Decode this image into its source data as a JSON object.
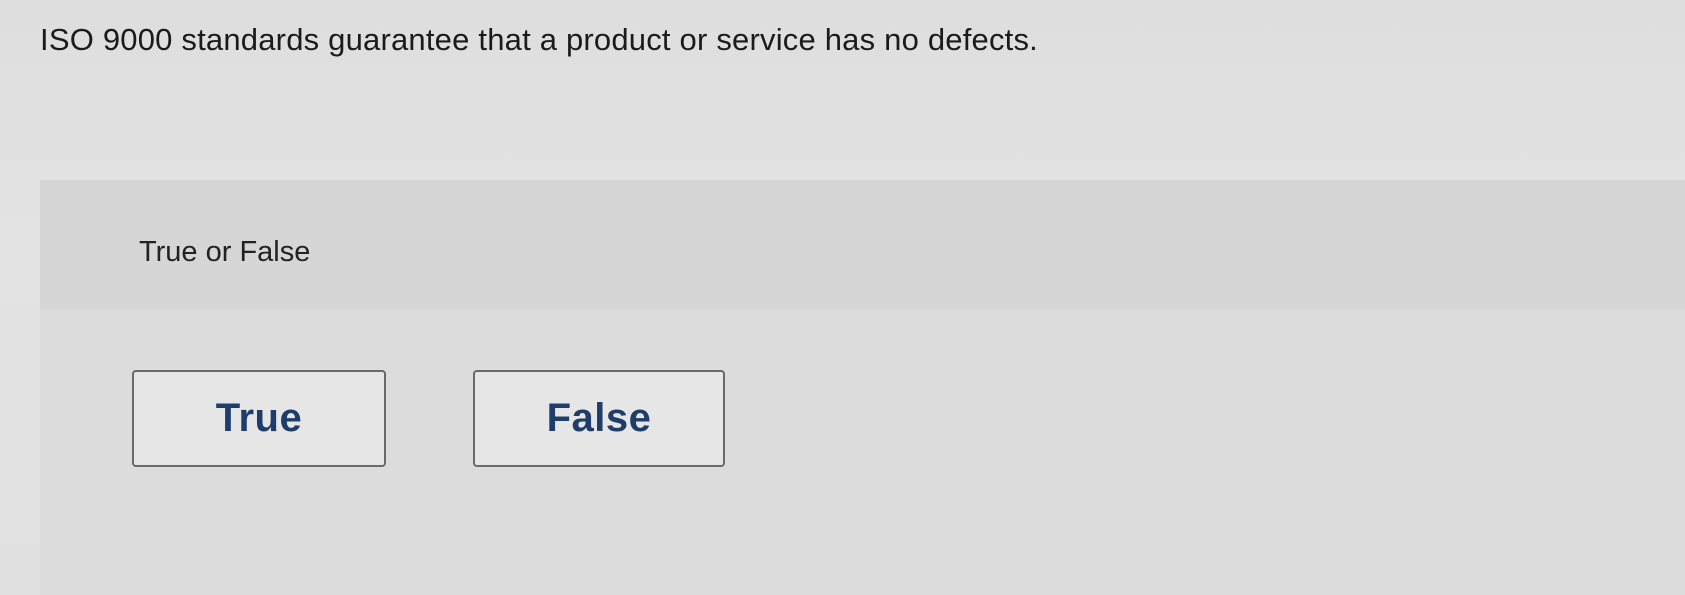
{
  "question": {
    "text": "ISO 9000 standards guarantee that a product or service has no defects."
  },
  "answer_area": {
    "prompt": "True or False",
    "choices": [
      {
        "label": "True"
      },
      {
        "label": "False"
      }
    ]
  },
  "colors": {
    "choice_text": "#1f3d6b",
    "choice_border": "#6a6a6a",
    "prompt_bar": "#d6d6d6"
  }
}
